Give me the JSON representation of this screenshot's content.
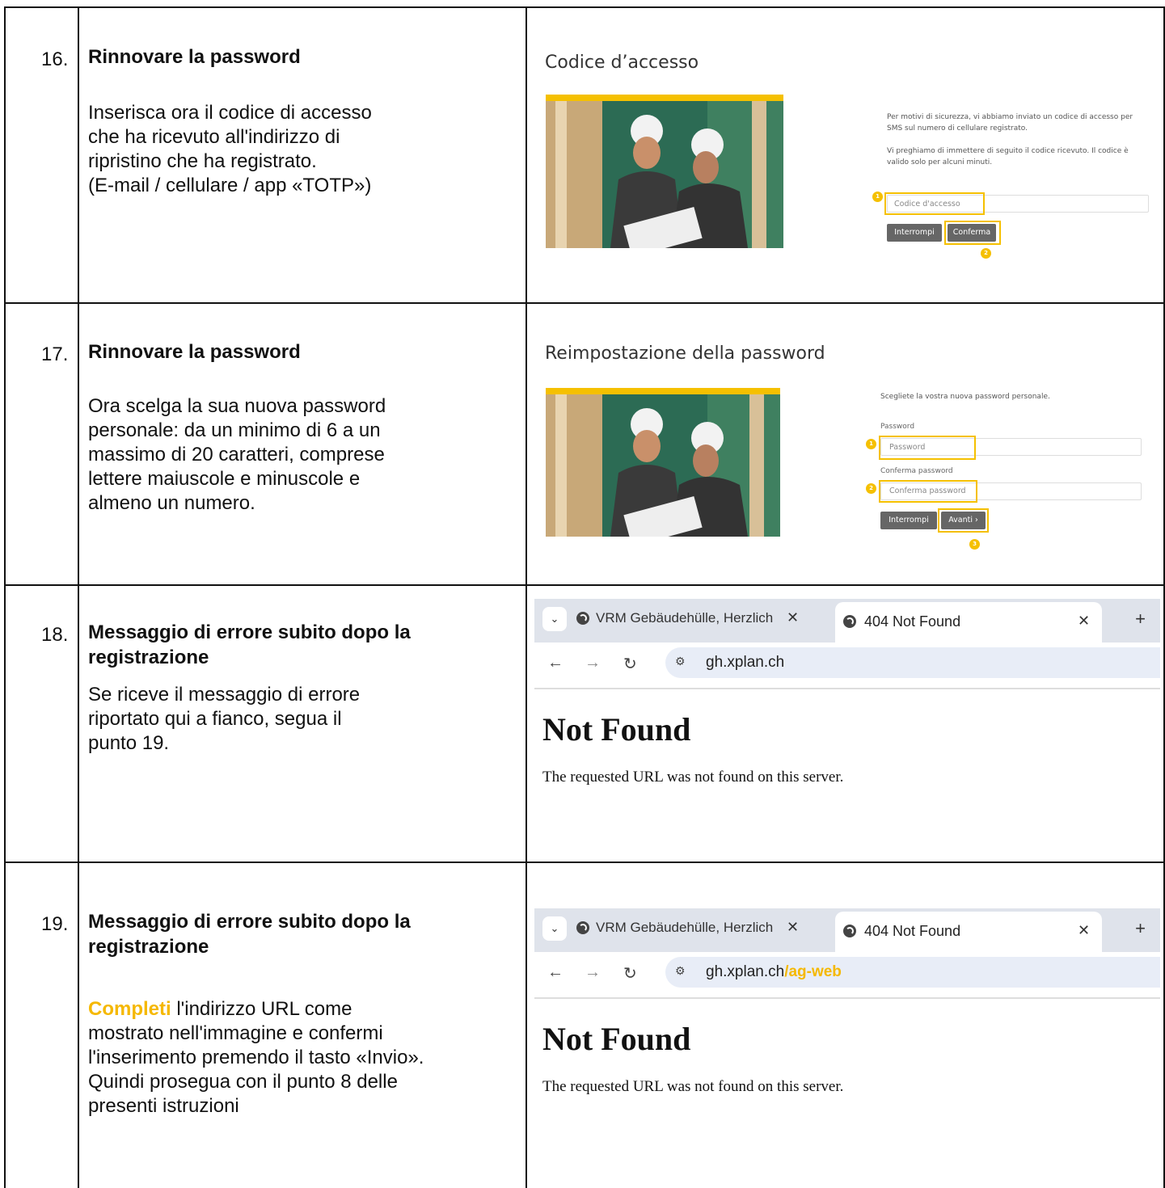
{
  "rows": [
    {
      "num": "16.",
      "title": "Rinnovare la password",
      "desc": [
        "Inserisca ora il codice di accesso",
        "che ha ricevuto all'indirizzo di",
        "ripristino che ha registrato.",
        "(E-mail / cellulare / app «TOTP»)"
      ],
      "screen": {
        "title": "Codice d’accesso",
        "text1": [
          "Per motivi di sicurezza, vi abbiamo inviato un codice di accesso per",
          "SMS sul numero di cellulare registrato."
        ],
        "text2": [
          "Vi preghiamo di immettere di seguito il codice ricevuto. Il codice è",
          "valido solo per alcuni minuti."
        ],
        "placeholder": "Codice d'accesso",
        "cancel": "Interrompi",
        "confirm": "Conferma",
        "badges": [
          "1",
          "2"
        ]
      }
    },
    {
      "num": "17.",
      "title": "Rinnovare la password",
      "desc": [
        "Ora scelga la sua nuova password",
        "personale: da un minimo di 6 a un",
        "massimo di 20 caratteri, comprese",
        "lettere maiuscole e minuscole e",
        "almeno un numero."
      ],
      "screen": {
        "title": "Reimpostazione della password",
        "text1": "Scegliete la vostra nuova password personale.",
        "label1": "Password",
        "placeholder1": "Password",
        "label2": "Conferma password",
        "placeholder2": "Conferma password",
        "cancel": "Interrompi",
        "next": "Avanti",
        "badges": [
          "1",
          "2",
          "3"
        ]
      }
    },
    {
      "num": "18.",
      "title": [
        "Messaggio di errore subito dopo la",
        "registrazione"
      ],
      "desc": [
        "Se riceve il messaggio di errore",
        "riportato qui a fianco, segua il",
        "punto 19."
      ],
      "browser": {
        "tab1": "VRM Gebäudehülle, Herzlich wi",
        "tab2": "404 Not Found",
        "url": "gh.xplan.ch",
        "url_suffix": "",
        "heading": "Not Found",
        "message": "The requested URL was not found on this server."
      }
    },
    {
      "num": "19.",
      "title": [
        "Messaggio di errore subito dopo la",
        "registrazione"
      ],
      "desc_highlight": "Completi",
      "desc_first": " l'indirizzo URL come",
      "desc": [
        "mostrato nell'immagine e confermi",
        "l'inserimento premendo il tasto «Invio».",
        "Quindi prosegua con il punto 8 delle",
        "presenti istruzioni"
      ],
      "browser": {
        "tab1": "VRM Gebäudehülle, Herzlich wi",
        "tab2": "404 Not Found",
        "url": "gh.xplan.ch",
        "url_suffix": "/ag-web",
        "heading": "Not Found",
        "message": "The requested URL was not found on this server."
      }
    }
  ],
  "icons": {
    "tab_dropdown": "chevron-down-icon",
    "tab_favicon": "globe-icon",
    "close": "close-icon",
    "new_tab": "plus-icon",
    "back": "arrow-left-icon",
    "forward": "arrow-right-icon",
    "reload": "reload-icon",
    "site_info": "site-settings-icon",
    "next_arrow": "chevron-right-icon"
  },
  "colors": {
    "accent": "#f5c000",
    "highlight_text": "#f5b800",
    "button": "#666666"
  }
}
